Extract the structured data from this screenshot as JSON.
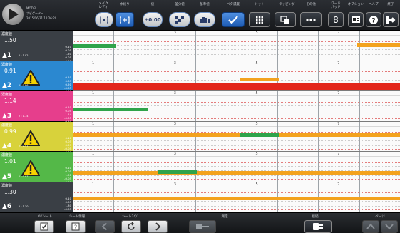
{
  "device": {
    "info_lines": [
      "MODEL",
      "ナビゲーター",
      "2015/06/21 12:26:20"
    ]
  },
  "toolbar": {
    "groups": [
      {
        "label": "メイク\nレディ",
        "icon": "bracket-dot-icon"
      },
      {
        "label": "水絞り",
        "icon": "bracket-expand-icon"
      },
      {
        "label": "値",
        "button": "±0.00"
      },
      {
        "label": "差分値",
        "icon": "checker-icon"
      },
      {
        "label": "基準値",
        "icon": "bars-icon"
      },
      {
        "label": "ベタ濃度",
        "icon": "check-icon"
      },
      {
        "label": "ドット",
        "icon": "grid-icon"
      },
      {
        "label": "トラッピング",
        "icon": "overlay-icon"
      },
      {
        "label": "その他",
        "icon": "dots-icon"
      },
      {
        "label": "ワード\nパッド",
        "button": "8"
      },
      {
        "label": "オプション",
        "icon": "card-icon"
      },
      {
        "label": "ヘルプ",
        "icon": "help-icon"
      },
      {
        "label": "終了",
        "icon": "exit-icon"
      }
    ]
  },
  "channels": [
    {
      "label": "濃度値",
      "value": "1.50",
      "number": "1",
      "small": "2 : 1.02",
      "scale": [
        "0.10",
        "0.05",
        "1.50",
        "-0.05",
        "-0.10"
      ],
      "color": "#3a3f45",
      "warning": false
    },
    {
      "label": "濃度値",
      "value": "0.91",
      "number": "2",
      "small": "2 : 0.86",
      "scale": [
        "0.10",
        "0.05",
        "0.91",
        "-0.05",
        "-0.10"
      ],
      "color": "#2b88d0",
      "warning": true
    },
    {
      "label": "濃度値",
      "value": "1.14",
      "number": "3",
      "small": "2 : 1.14",
      "scale": [
        "0.10",
        "0.05",
        "1.14",
        "-0.05",
        "-0.10"
      ],
      "color": "#e63e8c",
      "warning": false
    },
    {
      "label": "濃度値",
      "value": "0.99",
      "number": "4",
      "small": "2 : 0.97",
      "scale": [
        "0.10",
        "0.05",
        "0.99",
        "-0.05",
        "-0.10"
      ],
      "color": "#d8d23b",
      "warning": true
    },
    {
      "label": "濃度値",
      "value": "1.01",
      "number": "5",
      "small": "2 : 0.97",
      "scale": [
        "0.10",
        "0.05",
        "1.01",
        "-0.05",
        "-0.10"
      ],
      "color": "#54b848",
      "warning": true
    },
    {
      "label": "濃度値",
      "value": "1.30",
      "number": "6",
      "small": "2 : 1.30",
      "scale": [
        "0.10",
        "0.05",
        "1.30",
        "-0.05",
        "-0.10"
      ],
      "color": "#3a3f45",
      "warning": false
    }
  ],
  "grid": {
    "page_labels": [
      "1",
      "3",
      "5",
      "7"
    ],
    "bands": [
      {
        "segments": [
          [
            "green",
            0.0,
            0.13,
            0.45
          ],
          [
            "orange",
            0.87,
            1.0,
            0.42
          ]
        ]
      },
      {
        "segments": [
          [
            "red",
            0.0,
            1.0,
            0.72
          ],
          [
            "orange",
            0.51,
            0.63,
            0.55
          ]
        ]
      },
      {
        "segments": [
          [
            "green",
            0.0,
            0.23,
            0.55
          ]
        ]
      },
      {
        "segments": [
          [
            "orange",
            0.0,
            1.0,
            0.38
          ],
          [
            "green",
            0.51,
            0.63,
            0.38
          ]
        ]
      },
      {
        "segments": [
          [
            "orange",
            0.0,
            1.0,
            0.63
          ],
          [
            "green",
            0.26,
            0.38,
            0.6
          ]
        ]
      },
      {
        "segments": [
          [
            "orange",
            0.0,
            1.0,
            0.48
          ]
        ]
      }
    ]
  },
  "colors": {
    "green": "#2fa34a",
    "orange": "#f3a21e",
    "red": "#e3261b"
  },
  "bottombar": {
    "labels": [
      "OKシート",
      "シート情報",
      "シート2の1",
      "測定",
      "接続",
      "ページ"
    ]
  }
}
